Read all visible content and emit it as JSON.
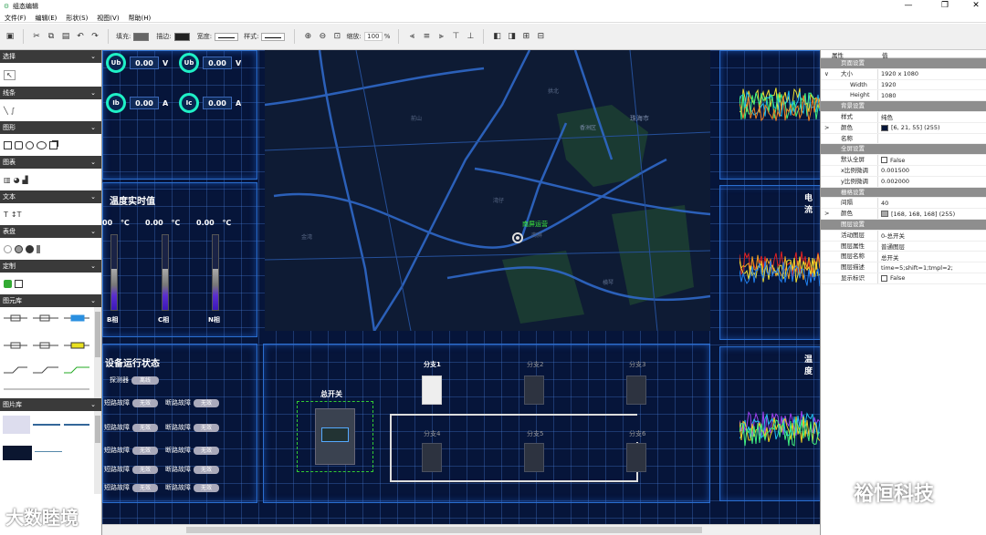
{
  "window": {
    "title": "组态编辑",
    "minimize": "—",
    "maximize": "❐",
    "close": "✕"
  },
  "menu": [
    "文件(F)",
    "编辑(E)",
    "形状(S)",
    "视图(V)",
    "帮助(H)"
  ],
  "toolbar": {
    "fill_label": "填充:",
    "stroke_label": "描边:",
    "width_label": "宽度:",
    "style_label": "样式:",
    "scale_label": "缩放:",
    "zoom_value": "100",
    "zoom_unit": "%"
  },
  "left_panel": {
    "sections": [
      "选择",
      "线条",
      "图形",
      "图表",
      "文本",
      "表盘",
      "定制",
      "图元库",
      "图片库"
    ],
    "text_tools": [
      "T",
      "↕T"
    ]
  },
  "canvas": {
    "gauges": [
      {
        "name": "Ub",
        "value": "0.00",
        "unit": "V"
      },
      {
        "name": "Ub",
        "value": "0.00",
        "unit": "V"
      },
      {
        "name": "Ib",
        "value": "0.00",
        "unit": "A"
      },
      {
        "name": "Ic",
        "value": "0.00",
        "unit": "A"
      }
    ],
    "temp_title": "温度实时值",
    "temps": [
      {
        "value": "00",
        "unit": "℃",
        "label": "B相",
        "level": 0.55
      },
      {
        "value": "0.00",
        "unit": "℃",
        "label": "C相",
        "level": 0.55
      },
      {
        "value": "0.00",
        "unit": "℃",
        "label": "N相",
        "level": 0.55
      }
    ],
    "device_title": "设备运行状态",
    "detector": {
      "label": "探测器",
      "status": "离线"
    },
    "status_rows": [
      {
        "a": "短路故障",
        "av": "无效",
        "b": "断路故障",
        "bv": "无效"
      },
      {
        "a": "短路故障",
        "av": "无效",
        "b": "断路故障",
        "bv": "无效"
      },
      {
        "a": "短路故障",
        "av": "无效",
        "b": "断路故障",
        "bv": "无效"
      },
      {
        "a": "短路故障",
        "av": "无效",
        "b": "断路故障",
        "bv": "无效"
      },
      {
        "a": "短路故障",
        "av": "无效",
        "b": "断路故障",
        "bv": "无效"
      }
    ],
    "main_switch": "总开关",
    "branches": [
      "分支1",
      "分支2",
      "分支3",
      "分支4",
      "分支5",
      "分支6"
    ],
    "map_marker": "南屏运营",
    "map_labels": [
      "珠海市",
      "香洲区",
      "前山",
      "南屏",
      "湾仔",
      "横琴",
      "金湾",
      "拱北"
    ],
    "right_titles": [
      "电流",
      "温度"
    ]
  },
  "properties": {
    "header": {
      "key": "属性",
      "value": "值"
    },
    "rows": [
      {
        "type": "cat",
        "key": "页面设置"
      },
      {
        "type": "row",
        "key": "大小",
        "value": "1920 x 1080",
        "expand": "∨"
      },
      {
        "type": "row",
        "key": "Width",
        "value": "1920",
        "indent": true
      },
      {
        "type": "row",
        "key": "Height",
        "value": "1080",
        "indent": true
      },
      {
        "type": "cat",
        "key": "背景设置"
      },
      {
        "type": "row",
        "key": "样式",
        "value": "纯色"
      },
      {
        "type": "row",
        "key": "颜色",
        "value": "[6, 21, 55] (255)",
        "color": "#061537",
        "expand": ">"
      },
      {
        "type": "row",
        "key": "名称",
        "value": ""
      },
      {
        "type": "cat",
        "key": "全屏设置"
      },
      {
        "type": "row",
        "key": "默认全屏",
        "value": "False",
        "check": true
      },
      {
        "type": "row",
        "key": "x比例微调",
        "value": "0.001500"
      },
      {
        "type": "row",
        "key": "y比例微调",
        "value": "0.002000"
      },
      {
        "type": "cat",
        "key": "栅格设置"
      },
      {
        "type": "row",
        "key": "间隔",
        "value": "40"
      },
      {
        "type": "row",
        "key": "颜色",
        "value": "[168, 168, 168] (255)",
        "color": "#a8a8a8",
        "expand": ">"
      },
      {
        "type": "cat",
        "key": "图层设置"
      },
      {
        "type": "row",
        "key": "活动图层",
        "value": "0-总开关"
      },
      {
        "type": "row",
        "key": "图层属性",
        "value": "普通图层"
      },
      {
        "type": "row",
        "key": "图层名称",
        "value": "总开关"
      },
      {
        "type": "row",
        "key": "图层描述",
        "value": "time=5;shift=1;tmpl=2;"
      },
      {
        "type": "row",
        "key": "显示标识",
        "value": "False",
        "check": true
      }
    ]
  },
  "watermarks": {
    "left": "大数睦境",
    "right": "裕恒科技"
  }
}
